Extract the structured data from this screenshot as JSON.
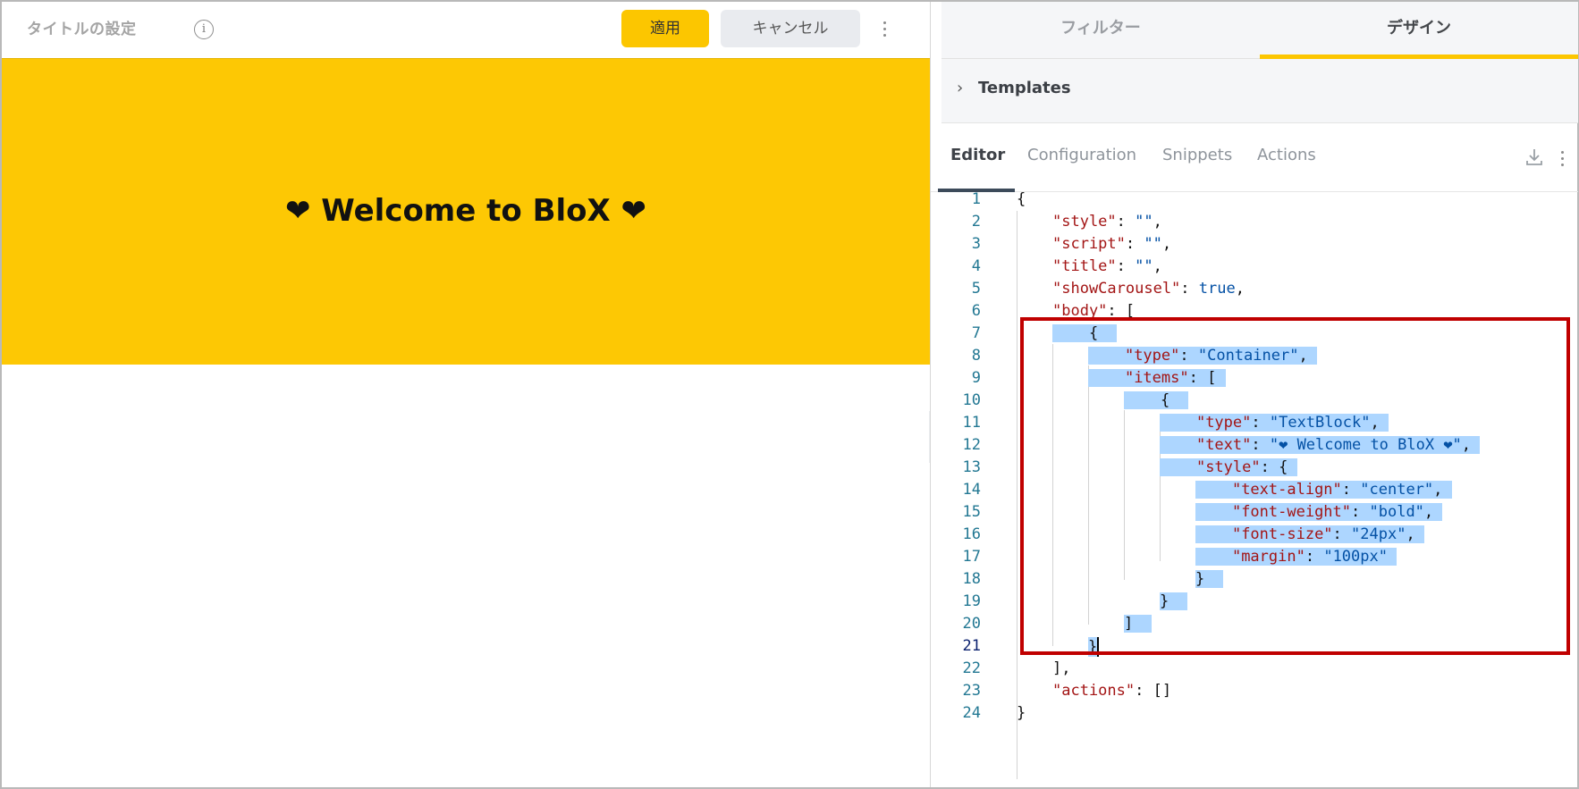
{
  "header": {
    "title": "タイトルの設定",
    "info_icon": "info-icon",
    "apply_label": "適用",
    "cancel_label": "キャンセル",
    "menu_icon": "more-vertical-icon"
  },
  "preview": {
    "banner_text": "❤ Welcome to BloX ❤",
    "banner_color": "#fdc804"
  },
  "panel_tabs": [
    {
      "label": "フィルター",
      "active": false
    },
    {
      "label": "デザイン",
      "active": true
    }
  ],
  "templates": {
    "label": "Templates",
    "icon": "chevron-right-icon"
  },
  "editor_tabs": [
    {
      "label": "Editor",
      "active": true
    },
    {
      "label": "Configuration",
      "active": false
    },
    {
      "label": "Snippets",
      "active": false
    },
    {
      "label": "Actions",
      "active": false
    }
  ],
  "editor_actions": {
    "download_icon": "download-icon",
    "menu_icon": "more-vertical-icon"
  },
  "code": {
    "line_numbers": [
      "1",
      "2",
      "3",
      "4",
      "5",
      "6",
      "7",
      "8",
      "9",
      "10",
      "11",
      "12",
      "13",
      "14",
      "15",
      "16",
      "17",
      "18",
      "19",
      "20",
      "21",
      "22",
      "23",
      "24"
    ],
    "tokens": {
      "open_brace": "{",
      "style_key": "\"style\"",
      "empty_str": "\"\"",
      "script_key": "\"script\"",
      "title_key": "\"title\"",
      "showCarousel_key": "\"showCarousel\"",
      "true_val": "true",
      "body_key": "\"body\"",
      "type_key": "\"type\"",
      "container_val": "\"Container\"",
      "items_key": "\"items\"",
      "textblock_val": "\"TextBlock\"",
      "text_key": "\"text\"",
      "text_val": "\"❤ Welcome to BloX ❤\"",
      "text_align_key": "\"text-align\"",
      "center_val": "\"center\"",
      "font_weight_key": "\"font-weight\"",
      "bold_val": "\"bold\"",
      "font_size_key": "\"font-size\"",
      "px24_val": "\"24px\"",
      "margin_key": "\"margin\"",
      "px100_val": "\"100px\"",
      "actions_key": "\"actions\"",
      "empty_arr": "[]"
    },
    "current_line": "21",
    "selection_color": "#add6ff",
    "highlight_color": "#c00000"
  }
}
